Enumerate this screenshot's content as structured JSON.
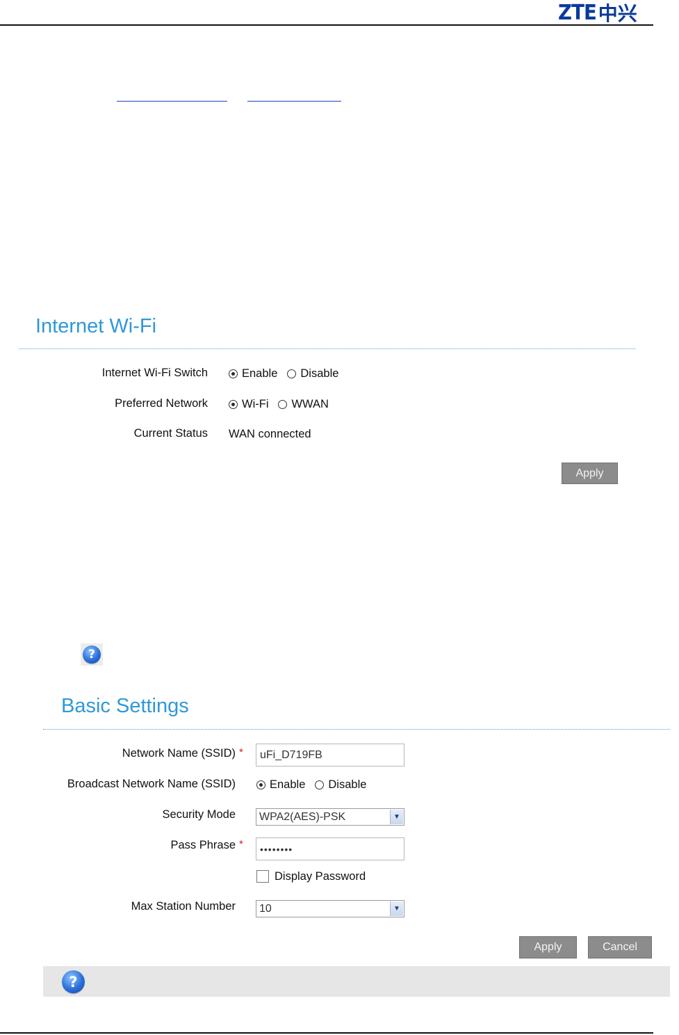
{
  "brand": {
    "logo_latin": "ZTE",
    "logo_chinese": "中兴",
    "color": "#0a3a9c"
  },
  "colors": {
    "accent": "#2f98d8",
    "button": "#8c8c8c",
    "required": "#d21b1b",
    "link": "#1c3fc8"
  },
  "internet_wifi": {
    "title": "Internet Wi-Fi",
    "switch_label": "Internet Wi-Fi Switch",
    "switch_options": [
      "Enable",
      "Disable"
    ],
    "switch_selected": "Enable",
    "network_label": "Preferred Network",
    "network_options": [
      "Wi-Fi",
      "WWAN"
    ],
    "network_selected": "Wi-Fi",
    "status_label": "Current Status",
    "status_value": "WAN connected",
    "apply_label": "Apply"
  },
  "basic_settings": {
    "title": "Basic Settings",
    "ssid_label": "Network Name (SSID)",
    "ssid_value": "uFi_D719FB",
    "required_mark": "*",
    "broadcast_label": "Broadcast Network Name (SSID)",
    "broadcast_options": [
      "Enable",
      "Disable"
    ],
    "broadcast_selected": "Enable",
    "security_label": "Security Mode",
    "security_value": "WPA2(AES)-PSK",
    "passphrase_label": "Pass Phrase",
    "passphrase_mask": "••••••••",
    "display_password_label": "Display Password",
    "display_password_checked": false,
    "max_station_label": "Max Station Number",
    "max_station_value": "10",
    "apply_label": "Apply",
    "cancel_label": "Cancel"
  },
  "icons": {
    "help": "help-question-icon",
    "dropdown": "chevron-down-icon"
  },
  "help_glyph": "?"
}
